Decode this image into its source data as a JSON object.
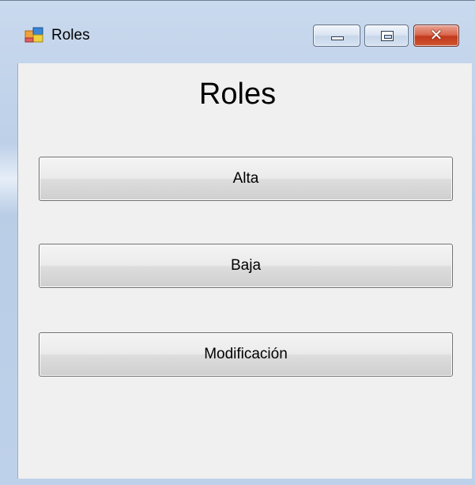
{
  "window": {
    "title": "Roles",
    "icon": "windows-form-icon",
    "controls": {
      "minimize": "minimize-icon",
      "maximize": "maximize-icon",
      "close": "close-icon",
      "close_glyph": "✕"
    }
  },
  "main": {
    "heading": "Roles",
    "buttons": [
      {
        "label": "Alta"
      },
      {
        "label": "Baja"
      },
      {
        "label": "Modificación"
      }
    ]
  },
  "colors": {
    "frame": "#c9d9ee",
    "client_bg": "#f0f0f0",
    "close_button": "#c23a1c"
  }
}
